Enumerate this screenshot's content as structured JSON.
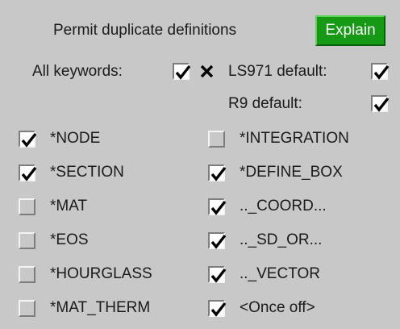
{
  "title": "Permit duplicate definitions",
  "explain_label": "Explain",
  "all_keywords_label": "All keywords:",
  "ls971_default_label": "LS971 default:",
  "r9_default_label": "R9 default:",
  "colors": {
    "explain_bg": "#169a16",
    "panel_bg": "#c8c8c8",
    "check": "#000000"
  },
  "left_options": [
    {
      "label": "*NODE",
      "checked": true
    },
    {
      "label": "*SECTION",
      "checked": true
    },
    {
      "label": "*MAT",
      "checked": false
    },
    {
      "label": "*EOS",
      "checked": false
    },
    {
      "label": "*HOURGLASS",
      "checked": false
    },
    {
      "label": "*MAT_THERM",
      "checked": false
    }
  ],
  "right_options": [
    {
      "label": "*INTEGRATION",
      "checked": false
    },
    {
      "label": "*DEFINE_BOX",
      "checked": true
    },
    {
      "label": ".._COORD...",
      "checked": true
    },
    {
      "label": ".._SD_OR...",
      "checked": true
    },
    {
      "label": ".._VECTOR",
      "checked": true
    },
    {
      "label": "<Once off>",
      "checked": true
    }
  ]
}
